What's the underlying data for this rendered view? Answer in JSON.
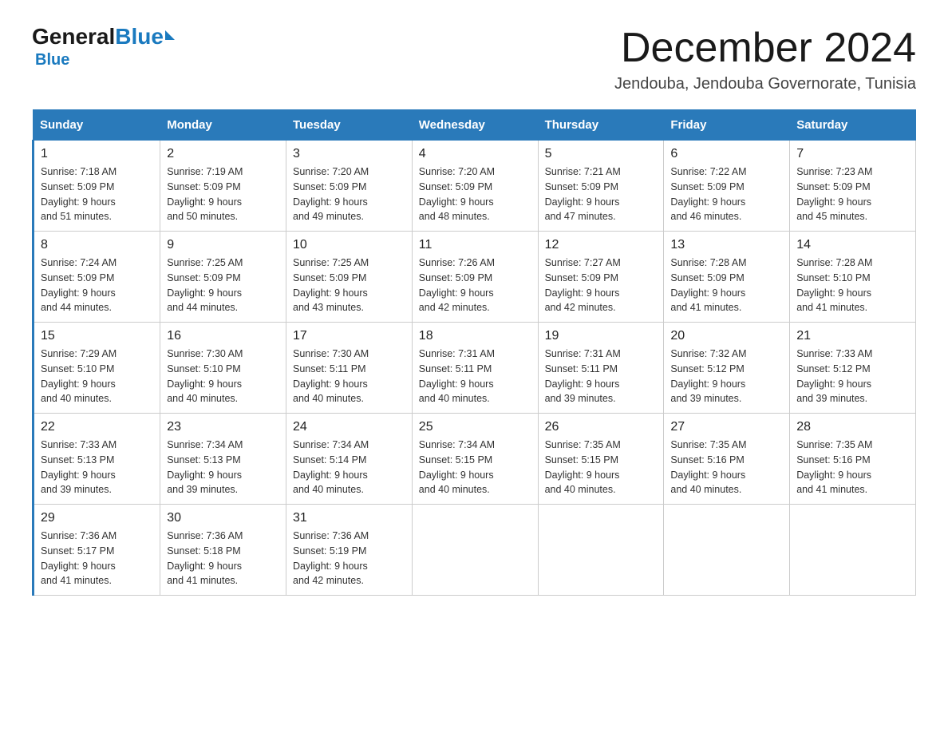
{
  "logo": {
    "general": "General",
    "blue": "Blue",
    "triangle": "▶"
  },
  "title": "December 2024",
  "location": "Jendouba, Jendouba Governorate, Tunisia",
  "days_of_week": [
    "Sunday",
    "Monday",
    "Tuesday",
    "Wednesday",
    "Thursday",
    "Friday",
    "Saturday"
  ],
  "weeks": [
    [
      {
        "day": "1",
        "sunrise": "7:18 AM",
        "sunset": "5:09 PM",
        "daylight": "9 hours and 51 minutes."
      },
      {
        "day": "2",
        "sunrise": "7:19 AM",
        "sunset": "5:09 PM",
        "daylight": "9 hours and 50 minutes."
      },
      {
        "day": "3",
        "sunrise": "7:20 AM",
        "sunset": "5:09 PM",
        "daylight": "9 hours and 49 minutes."
      },
      {
        "day": "4",
        "sunrise": "7:20 AM",
        "sunset": "5:09 PM",
        "daylight": "9 hours and 48 minutes."
      },
      {
        "day": "5",
        "sunrise": "7:21 AM",
        "sunset": "5:09 PM",
        "daylight": "9 hours and 47 minutes."
      },
      {
        "day": "6",
        "sunrise": "7:22 AM",
        "sunset": "5:09 PM",
        "daylight": "9 hours and 46 minutes."
      },
      {
        "day": "7",
        "sunrise": "7:23 AM",
        "sunset": "5:09 PM",
        "daylight": "9 hours and 45 minutes."
      }
    ],
    [
      {
        "day": "8",
        "sunrise": "7:24 AM",
        "sunset": "5:09 PM",
        "daylight": "9 hours and 44 minutes."
      },
      {
        "day": "9",
        "sunrise": "7:25 AM",
        "sunset": "5:09 PM",
        "daylight": "9 hours and 44 minutes."
      },
      {
        "day": "10",
        "sunrise": "7:25 AM",
        "sunset": "5:09 PM",
        "daylight": "9 hours and 43 minutes."
      },
      {
        "day": "11",
        "sunrise": "7:26 AM",
        "sunset": "5:09 PM",
        "daylight": "9 hours and 42 minutes."
      },
      {
        "day": "12",
        "sunrise": "7:27 AM",
        "sunset": "5:09 PM",
        "daylight": "9 hours and 42 minutes."
      },
      {
        "day": "13",
        "sunrise": "7:28 AM",
        "sunset": "5:09 PM",
        "daylight": "9 hours and 41 minutes."
      },
      {
        "day": "14",
        "sunrise": "7:28 AM",
        "sunset": "5:10 PM",
        "daylight": "9 hours and 41 minutes."
      }
    ],
    [
      {
        "day": "15",
        "sunrise": "7:29 AM",
        "sunset": "5:10 PM",
        "daylight": "9 hours and 40 minutes."
      },
      {
        "day": "16",
        "sunrise": "7:30 AM",
        "sunset": "5:10 PM",
        "daylight": "9 hours and 40 minutes."
      },
      {
        "day": "17",
        "sunrise": "7:30 AM",
        "sunset": "5:11 PM",
        "daylight": "9 hours and 40 minutes."
      },
      {
        "day": "18",
        "sunrise": "7:31 AM",
        "sunset": "5:11 PM",
        "daylight": "9 hours and 40 minutes."
      },
      {
        "day": "19",
        "sunrise": "7:31 AM",
        "sunset": "5:11 PM",
        "daylight": "9 hours and 39 minutes."
      },
      {
        "day": "20",
        "sunrise": "7:32 AM",
        "sunset": "5:12 PM",
        "daylight": "9 hours and 39 minutes."
      },
      {
        "day": "21",
        "sunrise": "7:33 AM",
        "sunset": "5:12 PM",
        "daylight": "9 hours and 39 minutes."
      }
    ],
    [
      {
        "day": "22",
        "sunrise": "7:33 AM",
        "sunset": "5:13 PM",
        "daylight": "9 hours and 39 minutes."
      },
      {
        "day": "23",
        "sunrise": "7:34 AM",
        "sunset": "5:13 PM",
        "daylight": "9 hours and 39 minutes."
      },
      {
        "day": "24",
        "sunrise": "7:34 AM",
        "sunset": "5:14 PM",
        "daylight": "9 hours and 40 minutes."
      },
      {
        "day": "25",
        "sunrise": "7:34 AM",
        "sunset": "5:15 PM",
        "daylight": "9 hours and 40 minutes."
      },
      {
        "day": "26",
        "sunrise": "7:35 AM",
        "sunset": "5:15 PM",
        "daylight": "9 hours and 40 minutes."
      },
      {
        "day": "27",
        "sunrise": "7:35 AM",
        "sunset": "5:16 PM",
        "daylight": "9 hours and 40 minutes."
      },
      {
        "day": "28",
        "sunrise": "7:35 AM",
        "sunset": "5:16 PM",
        "daylight": "9 hours and 41 minutes."
      }
    ],
    [
      {
        "day": "29",
        "sunrise": "7:36 AM",
        "sunset": "5:17 PM",
        "daylight": "9 hours and 41 minutes."
      },
      {
        "day": "30",
        "sunrise": "7:36 AM",
        "sunset": "5:18 PM",
        "daylight": "9 hours and 41 minutes."
      },
      {
        "day": "31",
        "sunrise": "7:36 AM",
        "sunset": "5:19 PM",
        "daylight": "9 hours and 42 minutes."
      },
      null,
      null,
      null,
      null
    ]
  ]
}
